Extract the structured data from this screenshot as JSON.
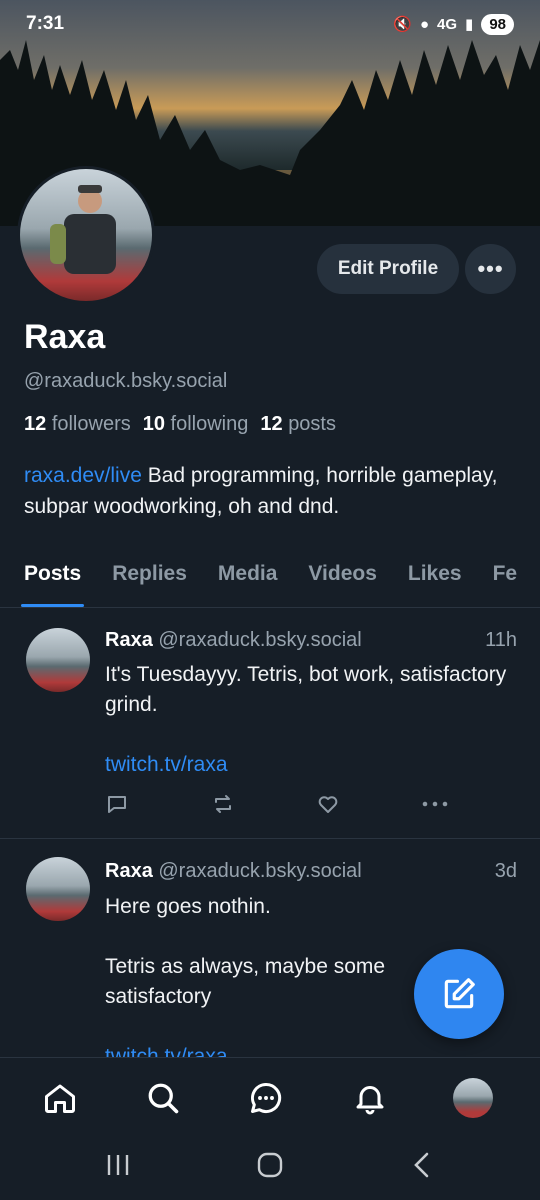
{
  "status_bar": {
    "time": "7:31",
    "network": "4G",
    "battery": "98"
  },
  "profile": {
    "name": "Raxa",
    "handle": "@raxaduck.bsky.social",
    "edit_label": "Edit Profile",
    "more_label": "•••",
    "followers_count": "12",
    "followers_label": "followers",
    "following_count": "10",
    "following_label": "following",
    "posts_count": "12",
    "posts_label": "posts",
    "bio_link": "raxa.dev/live",
    "bio_text": " Bad programming, horrible gameplay, subpar woodworking, oh and dnd."
  },
  "tabs": [
    "Posts",
    "Replies",
    "Media",
    "Videos",
    "Likes",
    "Fe"
  ],
  "posts": [
    {
      "author": "Raxa",
      "handle": "@raxaduck.bsky.social",
      "time": "11h",
      "text": "It's Tuesdayyy. Tetris, bot work, satisfactory grind.",
      "link": "twitch.tv/raxa"
    },
    {
      "author": "Raxa",
      "handle": "@raxaduck.bsky.social",
      "time": "3d",
      "text": "Here goes nothin.\n\nTetris as always, maybe some\nsatisfactory",
      "link": "twitch.tv/raxa"
    }
  ],
  "icons": {
    "nav": [
      "home-icon",
      "search-icon",
      "chat-icon",
      "bell-icon",
      "avatar"
    ],
    "post_actions": [
      "reply-icon",
      "repost-icon",
      "like-icon",
      "more-icon"
    ]
  },
  "colors": {
    "accent": "#2f8cf5",
    "background": "#161e27"
  }
}
